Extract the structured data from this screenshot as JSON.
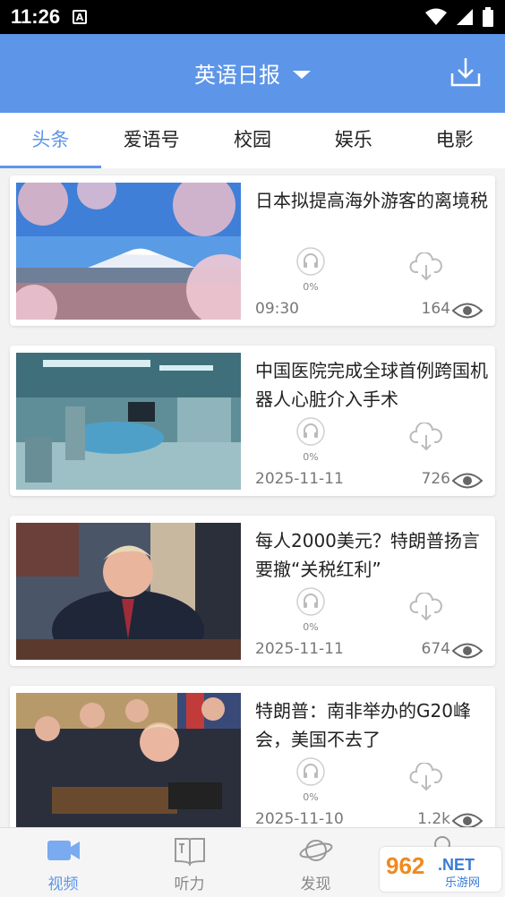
{
  "status_bar": {
    "time": "11:26",
    "notification_icon": "a-icon",
    "icons": [
      "wifi-icon",
      "signal-icon",
      "battery-icon"
    ]
  },
  "header": {
    "title": "英语日报",
    "dropdown_icon": "caret-down-icon",
    "action_icon": "download-icon"
  },
  "tabs": [
    {
      "label": "头条",
      "active": true
    },
    {
      "label": "爱语号",
      "active": false
    },
    {
      "label": "校园",
      "active": false
    },
    {
      "label": "娱乐",
      "active": false
    },
    {
      "label": "电影",
      "active": false
    }
  ],
  "articles": [
    {
      "title": "日本拟提高海外游客的离境税",
      "progress": "0%",
      "meta": "09:30",
      "views": "164"
    },
    {
      "title": "中国医院完成全球首例跨国机器人心脏介入手术",
      "progress": "0%",
      "meta": "2025-11-11",
      "views": "726"
    },
    {
      "title": "每人2000美元？特朗普扬言要撤“关税红利”",
      "progress": "0%",
      "meta": "2025-11-11",
      "views": "674"
    },
    {
      "title": "特朗普：南非举办的G20峰会，美国不去了",
      "progress": "0%",
      "meta": "2025-11-10",
      "views": "1.2k"
    }
  ],
  "bottom_nav": [
    {
      "label": "视频",
      "icon": "video-camera-icon",
      "active": true
    },
    {
      "label": "听力",
      "icon": "book-icon",
      "active": false
    },
    {
      "label": "发现",
      "icon": "planet-icon",
      "active": false
    },
    {
      "label": "",
      "icon": "user-icon",
      "active": false
    }
  ],
  "watermark": {
    "brand": "962",
    "domain": ".NET",
    "site": "乐游网"
  },
  "colors": {
    "accent": "#5d95e9",
    "muted": "#888888",
    "background": "#f2f2f2"
  }
}
